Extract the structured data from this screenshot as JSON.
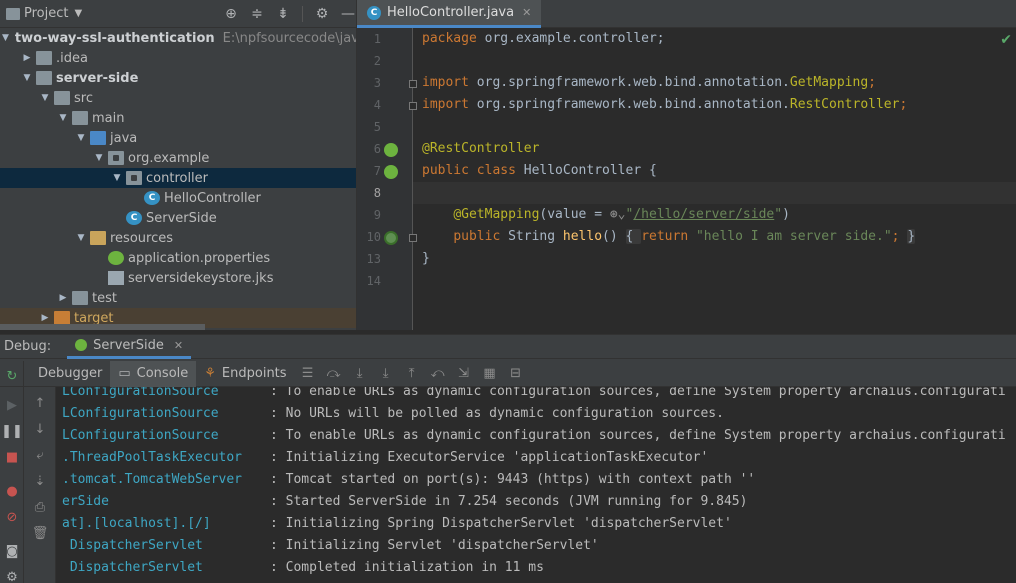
{
  "project_panel": {
    "title": "Project",
    "tree": [
      {
        "label": "two-way-ssl-authentication",
        "path": "E:\\npfsourcecode\\java\\s",
        "expanded": true,
        "icon": "module-folder-icon",
        "bold": true
      },
      {
        "label": ".idea",
        "expanded": false,
        "icon": "folder-icon"
      },
      {
        "label": "server-side",
        "expanded": true,
        "icon": "module-folder-icon",
        "bold": true
      },
      {
        "label": "src",
        "expanded": true,
        "icon": "folder-icon"
      },
      {
        "label": "main",
        "expanded": true,
        "icon": "folder-icon"
      },
      {
        "label": "java",
        "expanded": true,
        "icon": "source-folder-icon"
      },
      {
        "label": "org.example",
        "expanded": true,
        "icon": "package-icon"
      },
      {
        "label": "controller",
        "expanded": true,
        "icon": "package-icon",
        "selected": true
      },
      {
        "label": "HelloController",
        "icon": "class-icon"
      },
      {
        "label": "ServerSide",
        "icon": "spring-boot-class-icon"
      },
      {
        "label": "resources",
        "expanded": true,
        "icon": "resources-folder-icon"
      },
      {
        "label": "application.properties",
        "icon": "spring-properties-icon"
      },
      {
        "label": "serversidekeystore.jks",
        "icon": "file-icon"
      },
      {
        "label": "test",
        "expanded": false,
        "icon": "folder-icon"
      },
      {
        "label": "target",
        "expanded": false,
        "icon": "excluded-folder-icon"
      }
    ]
  },
  "editor": {
    "tab_label": "HelloController.java",
    "class_icon_letter": "C",
    "line_numbers": [
      "1",
      "2",
      "3",
      "4",
      "5",
      "6",
      "7",
      "8",
      "9",
      "10",
      "13",
      "14"
    ],
    "code": {
      "l1_kw": "package",
      "l1_rest": " org.example.controller;",
      "l3_kw": "import",
      "l3_rest": " org.springframework.web.bind.annotation.",
      "l3_ann": "GetMapping",
      "l3_end": ";",
      "l4_kw": "import",
      "l4_rest": " org.springframework.web.bind.annotation.",
      "l4_ann": "RestController",
      "l4_end": ";",
      "l6_ann": "@RestController",
      "l7_kw": "public class",
      "l7_rest": " HelloController {",
      "l9_ann": "@GetMapping",
      "l9_a": "(value = ",
      "l9_q1": "\"",
      "l9_url": "/hello/server/side",
      "l9_q2": "\"",
      "l9_close": ")",
      "l10_kw": "public",
      "l10_type": " String ",
      "l10_fn": "hello",
      "l10_paren": "() ",
      "l10_open": "{ ",
      "l10_ret": "return",
      "l10_str": " \"hello I am server side.\"",
      "l10_semi": "; ",
      "l10_close": "}",
      "l13": "}"
    }
  },
  "debug_panel": {
    "label": "Debug:",
    "session_tab": "ServerSide",
    "toolbar": {
      "debugger": "Debugger",
      "console": "Console",
      "endpoints": "Endpoints"
    },
    "console_lines": [
      {
        "src": "LConfigurationSource",
        "msg": ": To enable URLs as dynamic configuration sources, define System property archaius.configurati"
      },
      {
        "src": "LConfigurationSource",
        "msg": ": No URLs will be polled as dynamic configuration sources."
      },
      {
        "src": "LConfigurationSource",
        "msg": ": To enable URLs as dynamic configuration sources, define System property archaius.configurati"
      },
      {
        "src": ".ThreadPoolTaskExecutor",
        "msg": ": Initializing ExecutorService 'applicationTaskExecutor'"
      },
      {
        "src": ".tomcat.TomcatWebServer",
        "msg": ": Tomcat started on port(s): 9443 (https) with context path ''"
      },
      {
        "src": "erSide",
        "msg": ": Started ServerSide in 7.254 seconds (JVM running for 9.845)"
      },
      {
        "src": "at].[localhost].[/]",
        "msg": ": Initializing Spring DispatcherServlet 'dispatcherServlet'"
      },
      {
        "src": " DispatcherServlet",
        "msg": ": Initializing Servlet 'dispatcherServlet'"
      },
      {
        "src": " DispatcherServlet",
        "msg": ": Completed initialization in 11 ms"
      }
    ]
  }
}
